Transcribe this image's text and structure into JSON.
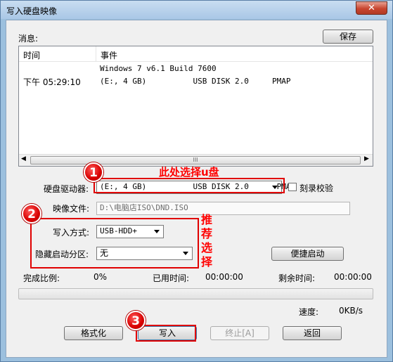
{
  "window": {
    "title": "写入硬盘映像",
    "close_label": "✕"
  },
  "messages": {
    "label": "消息:",
    "save_label": "保存",
    "columns": [
      "时间",
      "事件"
    ],
    "rows": [
      {
        "time": "",
        "event": "Windows 7 v6.1 Build 7600"
      },
      {
        "time": "下午 05:29:10",
        "event": "(E:, 4 GB)          USB DISK 2.0     PMAP"
      }
    ],
    "scroll_grip": "III"
  },
  "drive": {
    "label": "硬盘驱动器:",
    "value": "(E:, 4 GB)          USB DISK 2.0      PMAP",
    "verify_label": "刻录校验"
  },
  "image_file": {
    "label": "映像文件:",
    "value": "D:\\电脑店ISO\\DND.ISO"
  },
  "write_method": {
    "label": "写入方式:",
    "value": "USB-HDD+"
  },
  "hidden_partition": {
    "label": "隐藏启动分区:",
    "value": "无"
  },
  "quick_boot_label": "便捷启动",
  "progress": {
    "percent_label": "完成比例:",
    "percent_value": "0%",
    "elapsed_label": "已用时间:",
    "elapsed_value": "00:00:00",
    "remaining_label": "剩余时间:",
    "remaining_value": "00:00:00",
    "fill": 0,
    "speed_label": "速度:",
    "speed_value": "0KB/s"
  },
  "buttons": {
    "format": "格式化",
    "write": "写入",
    "abort": "终止[A]",
    "back": "返回"
  },
  "annotations": {
    "step1": "1",
    "step2": "2",
    "step3": "3",
    "usb_hint": "此处选择u盘",
    "recommend": [
      "推",
      "荐",
      "选",
      "择"
    ],
    "accent_color": "#e00000"
  }
}
